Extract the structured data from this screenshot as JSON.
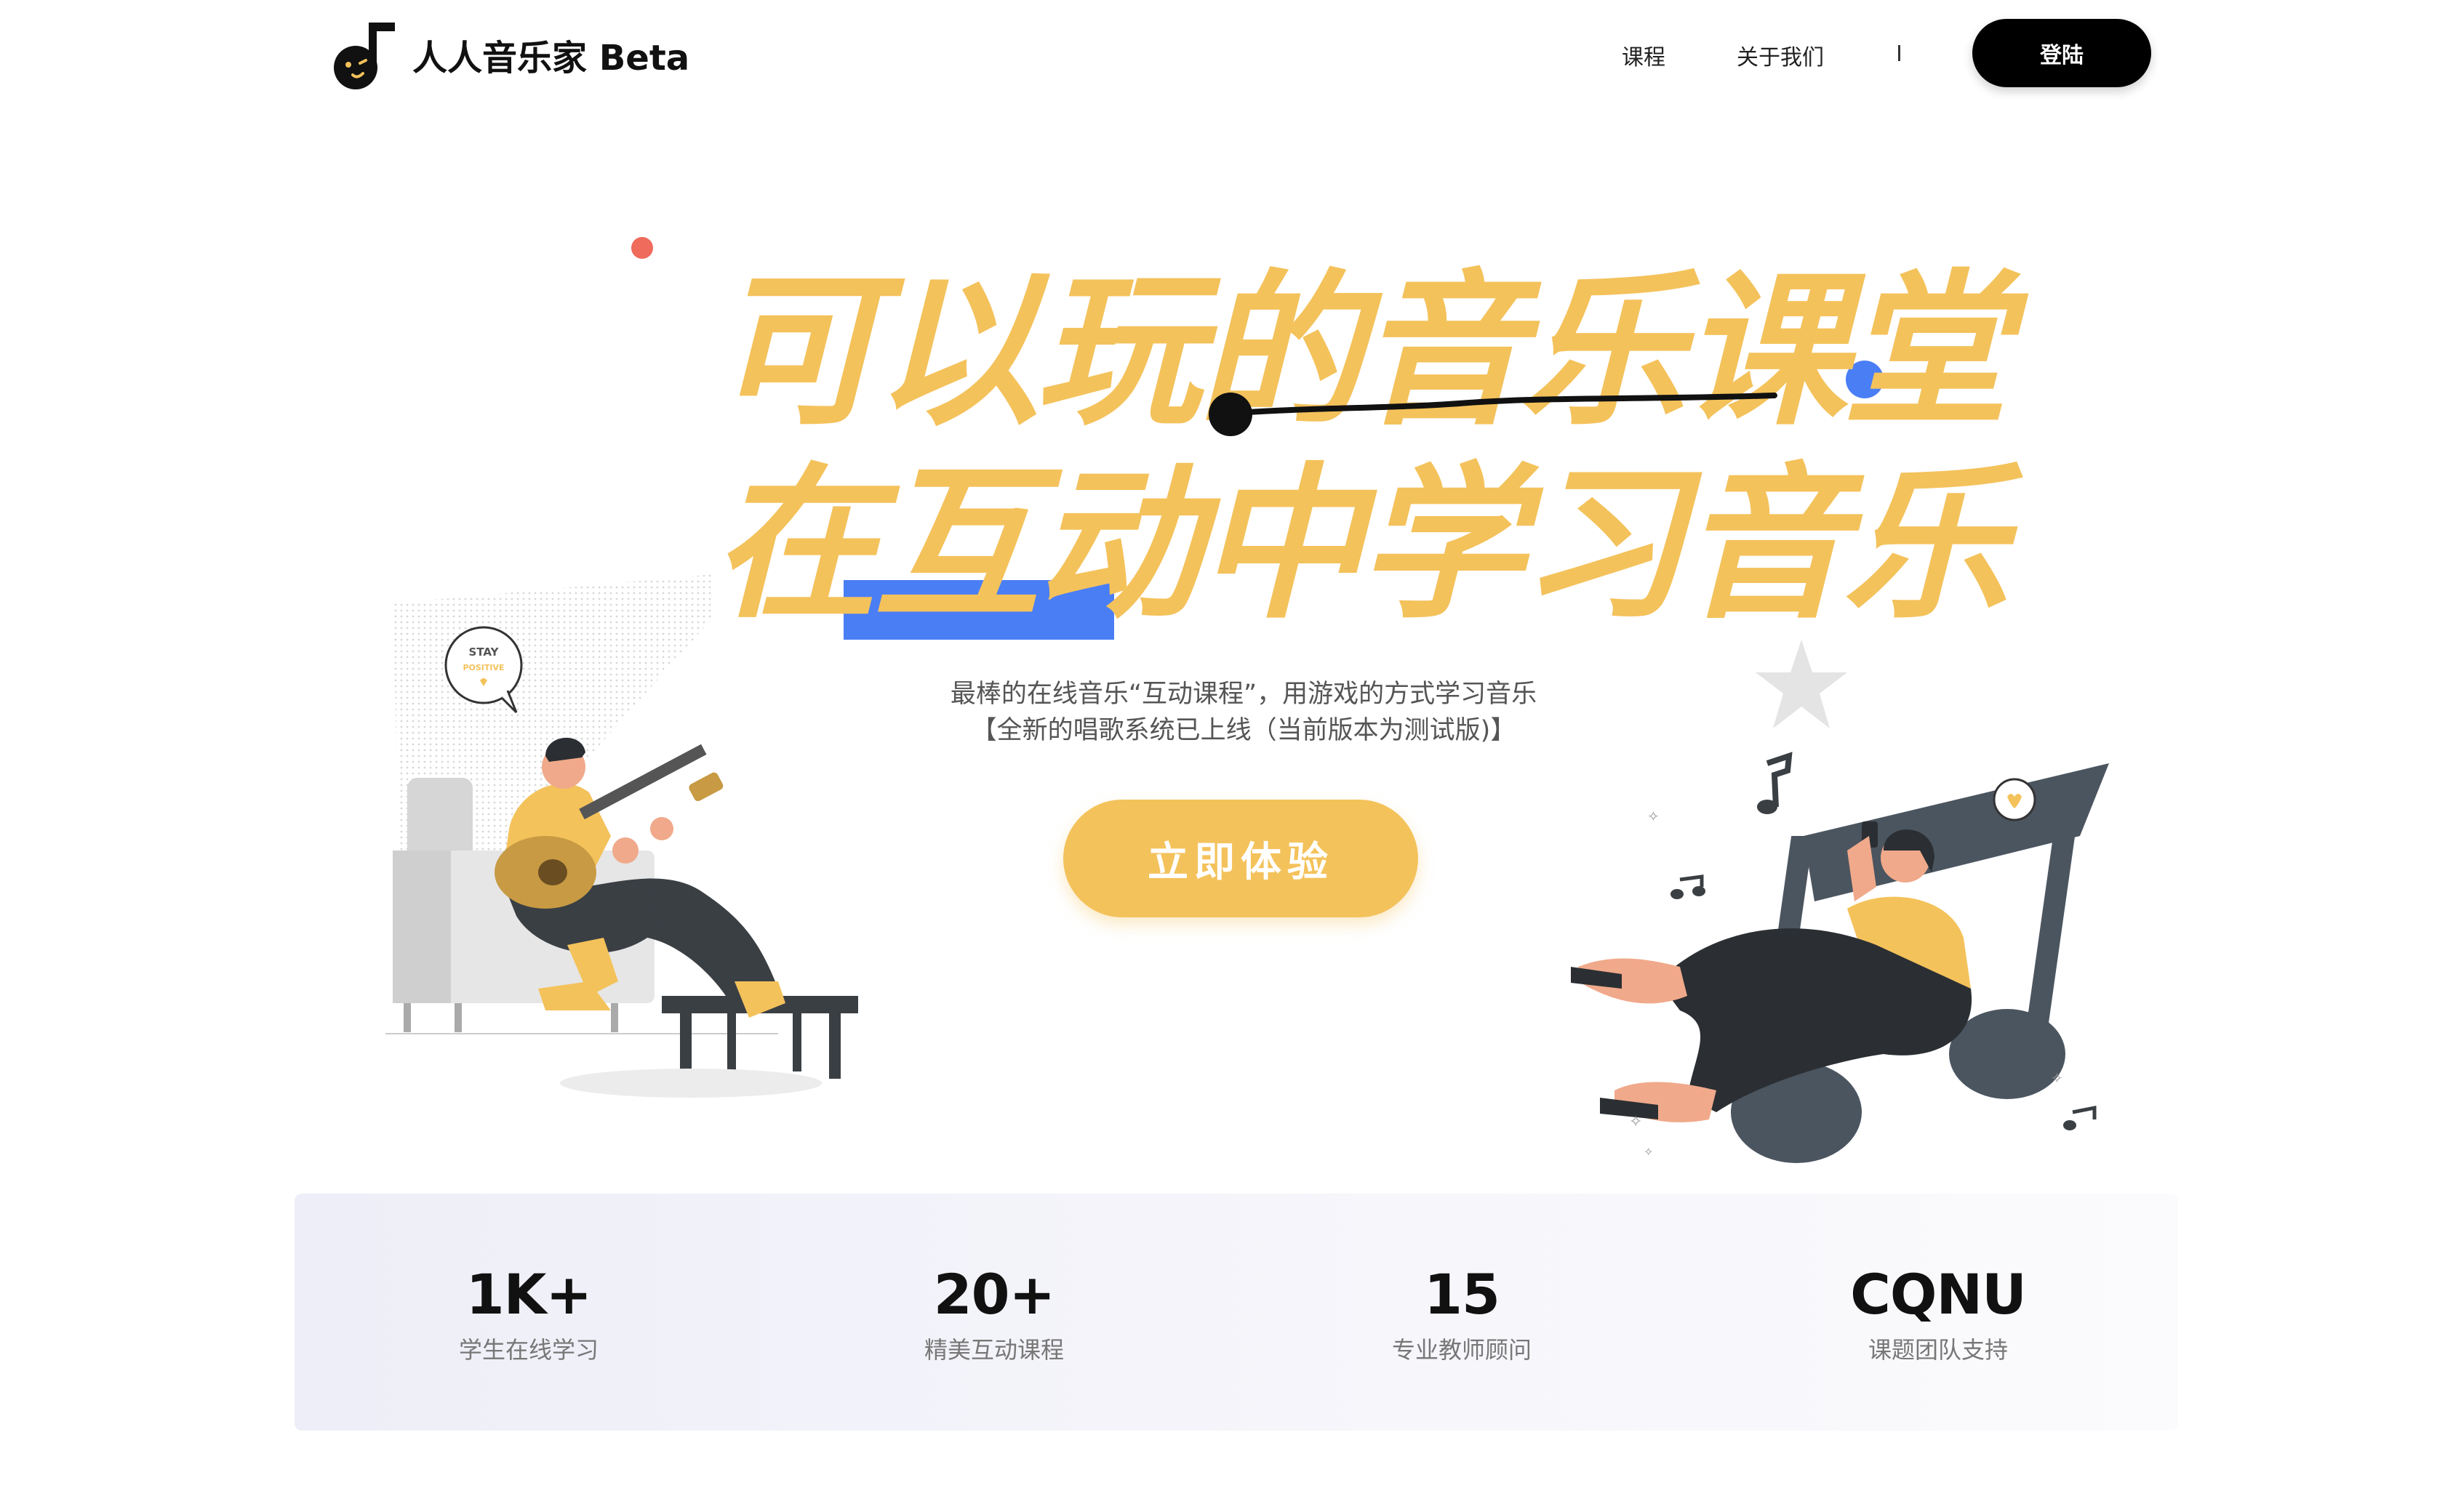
{
  "header": {
    "brand": "人人音乐家 Beta",
    "nav": {
      "courses": "课程",
      "about": "关于我们",
      "separator": "I"
    },
    "login_label": "登陆"
  },
  "hero": {
    "title_line1": "可以玩的音乐课堂",
    "title_line2": "在互动中学习音乐",
    "subtitle_line1": "最棒的在线音乐“互动课程”，用游戏的方式学习音乐",
    "subtitle_line2": "【全新的唱歌系统已上线（当前版本为测试版)】",
    "cta_label": "立即体验",
    "speech_bubble_line1": "STAY",
    "speech_bubble_line2": "POSITIVE"
  },
  "stats": [
    {
      "value": "1K+",
      "label": "学生在线学习"
    },
    {
      "value": "20+",
      "label": "精美互动课程"
    },
    {
      "value": "15",
      "label": "专业教师顾问"
    },
    {
      "value": "CQNU",
      "label": "课题团队支持"
    }
  ],
  "colors": {
    "accent_yellow": "#f4c25b",
    "accent_blue": "#4a7ef5",
    "accent_red": "#ef6b5b",
    "dark": "#111111",
    "slate": "#4b5560"
  },
  "icons": [
    "music-note-logo-icon",
    "star-icon",
    "heart-icon",
    "music-note-icon"
  ]
}
